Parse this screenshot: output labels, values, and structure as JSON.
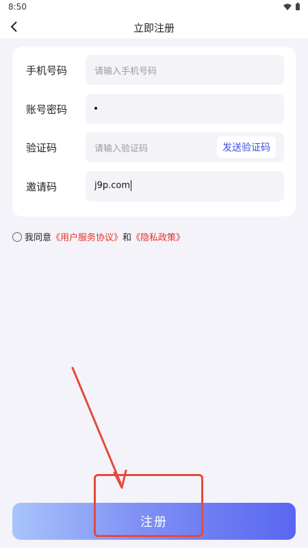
{
  "status": {
    "time": "8:50"
  },
  "nav": {
    "title": "立即注册"
  },
  "form": {
    "phone": {
      "label": "手机号码",
      "placeholder": "请输入手机号码"
    },
    "password": {
      "label": "账号密码",
      "value": "•"
    },
    "code": {
      "label": "验证码",
      "placeholder": "请输入验证码",
      "send_button": "发送验证码"
    },
    "invite": {
      "label": "邀请码",
      "value": "j9p.com"
    }
  },
  "agreement": {
    "prefix": "我同意",
    "terms": "《用户服务协议》",
    "conj": "和",
    "privacy": "《隐私政策》"
  },
  "register": {
    "label": "注册"
  },
  "colors": {
    "accent": "#3a4fe0",
    "link_red": "#e8312a",
    "annotation": "#e34a3b",
    "button_gradient": [
      "#a9c4fb",
      "#5966f1"
    ]
  },
  "icons": [
    "wifi-icon",
    "battery-icon",
    "back-arrow-icon",
    "radio-icon",
    "annotation-arrow-icon"
  ]
}
